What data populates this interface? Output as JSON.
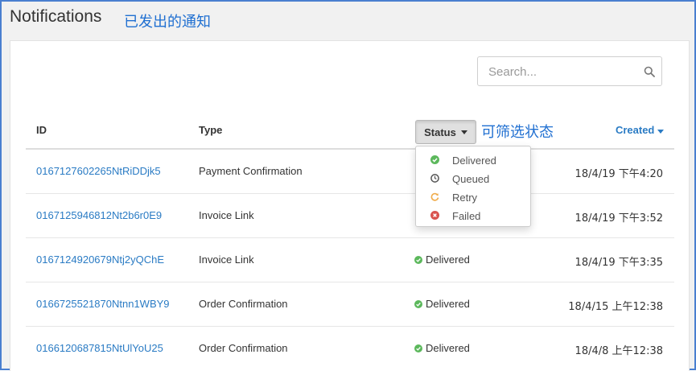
{
  "header": {
    "title": "Notifications",
    "annotation": "已发出的通知"
  },
  "search": {
    "placeholder": "Search..."
  },
  "table": {
    "columns": {
      "id": "ID",
      "type": "Type",
      "status": "Status",
      "created": "Created"
    },
    "status_annotation": "可筛选状态",
    "rows": [
      {
        "id": "0167127602265NtRiDDjk5",
        "type": "Payment Confirmation",
        "status": "",
        "created": "18/4/19 下午4:20"
      },
      {
        "id": "0167125946812Nt2b6r0E9",
        "type": "Invoice Link",
        "status": "",
        "created": "18/4/19 下午3:52"
      },
      {
        "id": "0167124920679Ntj2yQChE",
        "type": "Invoice Link",
        "status": "Delivered",
        "created": "18/4/19 下午3:35"
      },
      {
        "id": "0166725521870Ntnn1WBY9",
        "type": "Order Confirmation",
        "status": "Delivered",
        "created": "18/4/15 上午12:38"
      },
      {
        "id": "0166120687815NtUlYoU25",
        "type": "Order Confirmation",
        "status": "Delivered",
        "created": "18/4/8 上午12:38"
      }
    ]
  },
  "status_dropdown": {
    "items": [
      {
        "label": "Delivered",
        "icon": "check-circle-icon",
        "color": "#5cb85c"
      },
      {
        "label": "Queued",
        "icon": "clock-icon",
        "color": "#555555"
      },
      {
        "label": "Retry",
        "icon": "retry-icon",
        "color": "#f0ad4e"
      },
      {
        "label": "Failed",
        "icon": "x-circle-icon",
        "color": "#d9534f"
      }
    ]
  },
  "colors": {
    "link": "#2a7bc4",
    "annotation": "#1f6fd1",
    "delivered": "#5cb85c"
  }
}
